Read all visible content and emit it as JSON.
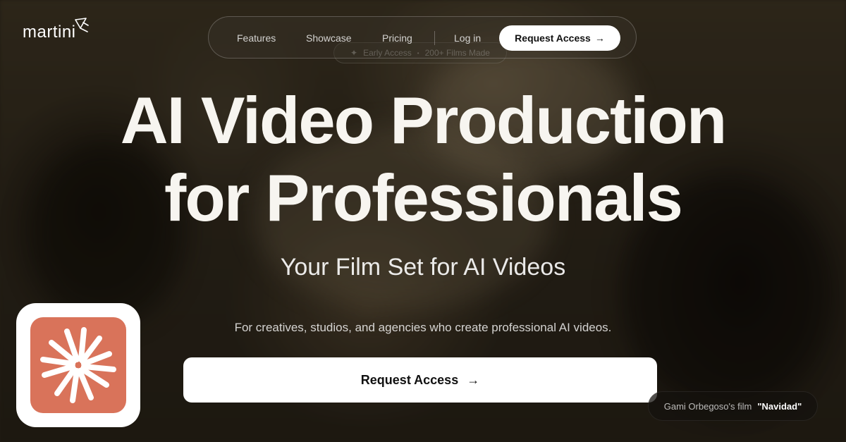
{
  "brand": {
    "name": "martini"
  },
  "nav": {
    "items": [
      {
        "label": "Features"
      },
      {
        "label": "Showcase"
      },
      {
        "label": "Pricing"
      }
    ],
    "login": "Log in",
    "cta": "Request Access"
  },
  "pill": {
    "badge": "Early Access",
    "count": "200+ Films Made"
  },
  "hero": {
    "title_line1": "AI Video Production",
    "title_line2": "for Professionals",
    "subtitle": "Your Film Set for AI Videos",
    "description": "For creatives, studios, and agencies who create professional AI videos.",
    "cta": "Request Access"
  },
  "credit": {
    "by": "Gami Orbegoso's film",
    "film": "\"Navidad\""
  },
  "icons": {
    "arrow": "arrow-right-icon",
    "sparkle": "sparkle-icon",
    "app": "starburst-app-icon"
  },
  "colors": {
    "accent": "#d9735a",
    "button_bg": "#ffffff",
    "text": "#ffffff"
  }
}
